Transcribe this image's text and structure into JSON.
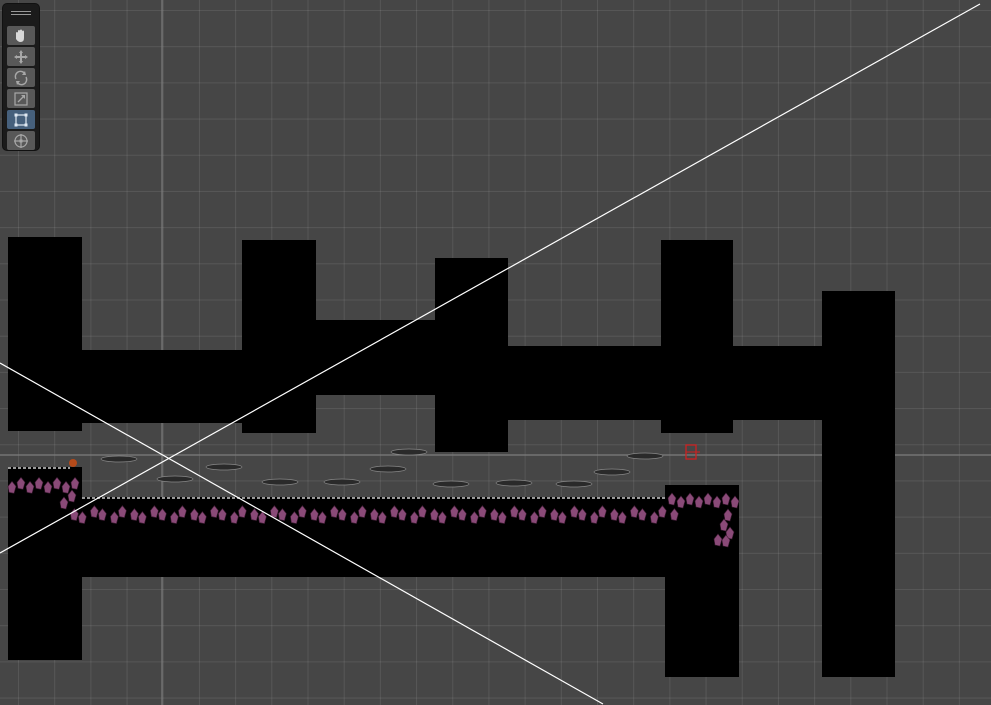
{
  "app": {
    "view": "scene-view",
    "background_color": "#464646",
    "grid_color": "#5a5a5a"
  },
  "toolbar": {
    "tools": [
      {
        "name": "hand-tool",
        "icon": "hand-icon",
        "active": false
      },
      {
        "name": "move-tool",
        "icon": "move-arrows-icon",
        "active": false
      },
      {
        "name": "rotate-tool",
        "icon": "rotate-icon",
        "active": false
      },
      {
        "name": "scale-tool",
        "icon": "scale-icon",
        "active": false
      },
      {
        "name": "rect-tool",
        "icon": "rect-transform-icon",
        "active": true
      },
      {
        "name": "transform-tool",
        "icon": "transform-icon",
        "active": false
      }
    ],
    "active_color": "#46607c"
  },
  "scene": {
    "level_color": "#000000",
    "crystal_color": "#8a4a78",
    "platform_color": "#2a2a2a",
    "gizmo_line_color": "#ffffff",
    "selected_object_color": "#cc2222"
  }
}
